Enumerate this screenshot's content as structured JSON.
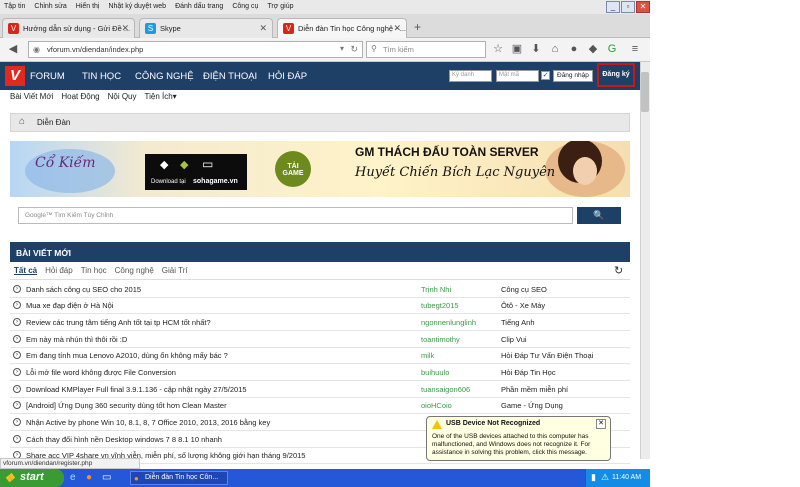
{
  "menubar": [
    "Tập tin",
    "Chỉnh sửa",
    "Hiển thị",
    "Nhật ký duyệt web",
    "Đánh dấu trang",
    "Công cụ",
    "Trợ giúp"
  ],
  "tabs": [
    {
      "label": "Hướng dẫn sử dụng - Gửi Đề ...",
      "icon": "V"
    },
    {
      "label": "Skype",
      "icon": "S"
    },
    {
      "label": "Diễn đàn Tin học Công nghệ - ...",
      "icon": "V"
    }
  ],
  "nav": {
    "url": "vforum.vn/diendan/index.php",
    "search_placeholder": "Tìm kiếm"
  },
  "site": {
    "logo": "V",
    "links": [
      "FORUM",
      "TIN HỌC",
      "CÔNG NGHỆ",
      "ĐIỆN THOẠI",
      "HỎI ĐÁP"
    ],
    "username_placeholder": "Ký danh",
    "password_placeholder": "Mật mã",
    "login_label": "Đăng nhập",
    "register_label": "Đăng ký"
  },
  "subnav": [
    "Bài Viết Mới",
    "Hoạt Động",
    "Nội Quy",
    "Tiện Ích"
  ],
  "breadcrumb": "Diễn Đàn",
  "banner": {
    "title": "Cổ Kiếm",
    "download": "Download tại",
    "site": "sohagame.vn",
    "game_badge": "TẢI GAME",
    "headline": "GM THÁCH ĐẤU TOÀN SERVER",
    "subline": "Huyết Chiến Bích Lạc Nguyên"
  },
  "search": {
    "placeholder": "Google™ Tìm Kiếm Tùy Chỉnh",
    "button": "🔍"
  },
  "posts": {
    "header": "BÀI VIẾT MỚI",
    "tabs": [
      "Tất cả",
      "Hỏi đáp",
      "Tin học",
      "Công nghệ",
      "Giải Trí"
    ],
    "rows": [
      {
        "title": "Danh sách công cụ SEO cho 2015",
        "author": "Trịnh Nhi",
        "category": "Công cụ SEO"
      },
      {
        "title": "Mua xe đạp điện ở Hà Nội",
        "author": "tubegt2015",
        "category": "Ôtô - Xe Máy"
      },
      {
        "title": "Review các trung tâm tiếng Anh tốt tại tp HCM tốt nhất?",
        "author": "ngonnenlunglinh",
        "category": "Tiếng Anh"
      },
      {
        "title": "Em này mà nhún thì thôi rồi :D",
        "author": "toantimothy",
        "category": "Clip Vui"
      },
      {
        "title": "Em đang tính mua Lenovo A2010, dùng ổn không mấy bác ?",
        "author": "milk",
        "category": "Hỏi Đáp Tư Vấn Điện Thoại"
      },
      {
        "title": "Lỗi mở file word không được File Conversion",
        "author": "buihuulo",
        "category": "Hỏi Đáp Tin Học"
      },
      {
        "title": "Download KMPlayer Full final 3.9.1.136 - cập nhật ngày 27/5/2015",
        "author": "tuansaigon606",
        "category": "Phần mềm miễn phí"
      },
      {
        "title": "[Android] Ứng Dụng 360 security dùng tốt hơn Clean Master",
        "author": "oioHCoio",
        "category": "Game - Ứng Dụng"
      },
      {
        "title": "Nhận Active by phone Win 10, 8.1, 8, 7 Office 2010, 2013, 2016 bằng key",
        "author": "",
        "category": ""
      },
      {
        "title": "Cách thay đổi hình nền Desktop windows 7 8 8.1 10 nhanh",
        "author": "",
        "category": ""
      },
      {
        "title": "Share acc VIP 4share vn vĩnh viễn, miễn phí, số lượng không giới hạn tháng 9/2015",
        "author": "",
        "category": ""
      }
    ]
  },
  "status_url": "vforum.vn/diendan/register.php",
  "notification": {
    "title": "USB Device Not Recognized",
    "body": "One of the USB devices attached to this computer has malfunctioned, and Windows does not recognize it. For assistance in solving this problem, click this message."
  },
  "taskbar": {
    "start": "start",
    "task": "Diễn đàn Tin học Côn...",
    "time": "11:40 AM"
  }
}
